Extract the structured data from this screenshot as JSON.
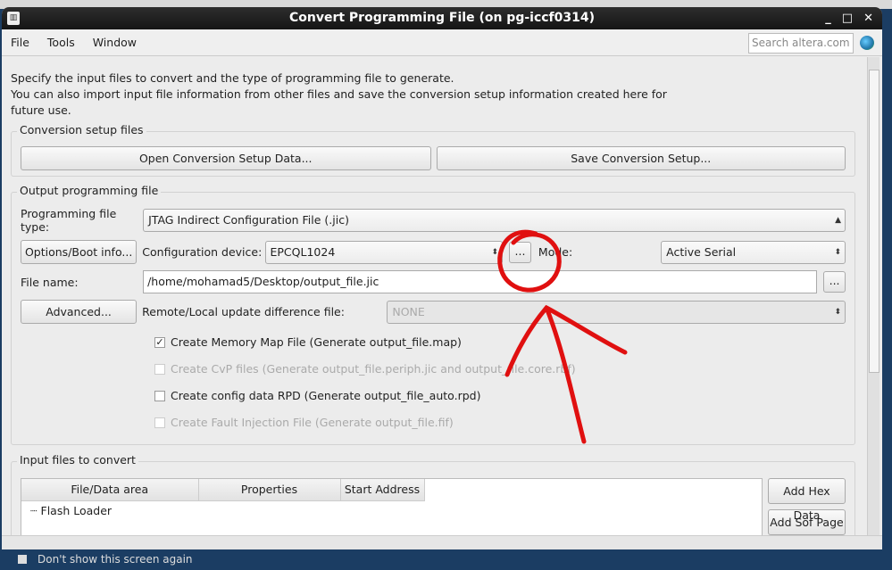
{
  "window": {
    "title": "Convert Programming File (on pg-iccf0314)",
    "minimize": "_",
    "maximize": "□",
    "close": "✕"
  },
  "menu": [
    {
      "label": "File"
    },
    {
      "label": "Tools"
    },
    {
      "label": "Window"
    }
  ],
  "search": {
    "placeholder": "Search altera.com"
  },
  "intro": {
    "line1": "Specify the input files to convert and the type of programming file to generate.",
    "line2": "You can also import input file information from other files and save the conversion setup information created here for",
    "line3": "future use."
  },
  "setup": {
    "label": "Conversion setup files",
    "open": "Open Conversion Setup Data...",
    "save": "Save Conversion Setup..."
  },
  "output": {
    "label": "Output programming file",
    "type_label": "Programming file type:",
    "type_value": "JTAG Indirect Configuration File (.jic)",
    "options_btn": "Options/Boot info...",
    "device_label": "Configuration device:",
    "device_value": "EPCQL1024",
    "browse": "...",
    "mode_label": "Mode:",
    "mode_value": "Active Serial",
    "file_label": "File name:",
    "file_value": "/home/mohamad5/Desktop/output_file.jic",
    "advanced_btn": "Advanced...",
    "remote_label": "Remote/Local update difference file:",
    "remote_value": "NONE",
    "checks": [
      {
        "label": "Create Memory Map File (Generate output_file.map)",
        "checked": true,
        "enabled": true
      },
      {
        "label": "Create CvP files (Generate output_file.periph.jic and output_file.core.rbf)",
        "checked": false,
        "enabled": false
      },
      {
        "label": "Create config data RPD (Generate output_file_auto.rpd)",
        "checked": false,
        "enabled": true
      },
      {
        "label": "Create Fault Injection File (Generate output_file.fif)",
        "checked": false,
        "enabled": false
      }
    ]
  },
  "input": {
    "label": "Input files to convert",
    "columns": [
      "File/Data area",
      "Properties",
      "Start Address"
    ],
    "rows": [
      "Flash Loader"
    ],
    "add_hex": "Add Hex Data",
    "add_sof": "Add Sof Page"
  },
  "behind": {
    "text": "Don't show this screen again"
  },
  "annotation_color": "#e01010"
}
